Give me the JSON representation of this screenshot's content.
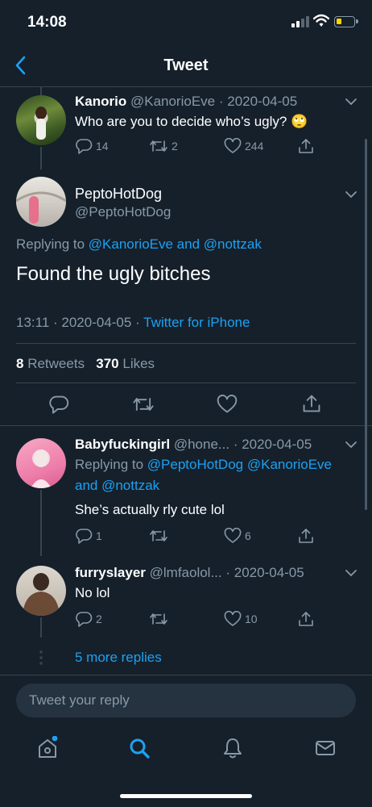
{
  "status_bar": {
    "time": "14:08"
  },
  "nav": {
    "title": "Tweet"
  },
  "parent_tweet": {
    "name": "Kanorio",
    "handle": "@KanorioEve",
    "date": "· 2020-04-05",
    "text": "Who are you to decide who’s ugly? 🙄",
    "replies": "14",
    "retweets": "2",
    "likes": "244"
  },
  "main_tweet": {
    "name": "PeptoHotDog",
    "handle": "@PeptoHotDog",
    "replying_prefix": "Replying to",
    "replying_to": "@KanorioEve and @nottzak",
    "text": "Found the ugly bitches",
    "time": "13:11 · 2020-04-05 ·",
    "source": "Twitter for iPhone",
    "retweet_count": "8",
    "retweet_label": "Retweets",
    "like_count": "370",
    "like_label": "Likes"
  },
  "replies": [
    {
      "name": "Babyfuckingirl",
      "handle": "@hone...",
      "date": "· 2020-04-05",
      "replying_prefix": "Replying to",
      "replying_line1": "@PeptoHotDog @KanorioEve",
      "replying_line2": "and @nottzak",
      "text": "She’s actually rly cute lol",
      "replies": "1",
      "retweets": "",
      "likes": "6"
    },
    {
      "name": "furryslayer",
      "handle": "@lmfaolol...",
      "date": "· 2020-04-05",
      "text": "No lol",
      "replies": "2",
      "retweets": "",
      "likes": "10"
    }
  ],
  "more_replies": "5 more replies",
  "composer": {
    "placeholder": "Tweet your reply"
  },
  "icons": {
    "back": "chevron-left-icon",
    "reply": "comment-icon",
    "retweet": "retweet-icon",
    "like": "heart-icon",
    "share": "share-icon",
    "home": "home-icon",
    "search": "search-icon",
    "notifications": "bell-icon",
    "messages": "mail-icon"
  },
  "colors": {
    "background": "#15202b",
    "accent": "#1da1f2",
    "muted": "#8899a6",
    "divider": "#38444d"
  }
}
